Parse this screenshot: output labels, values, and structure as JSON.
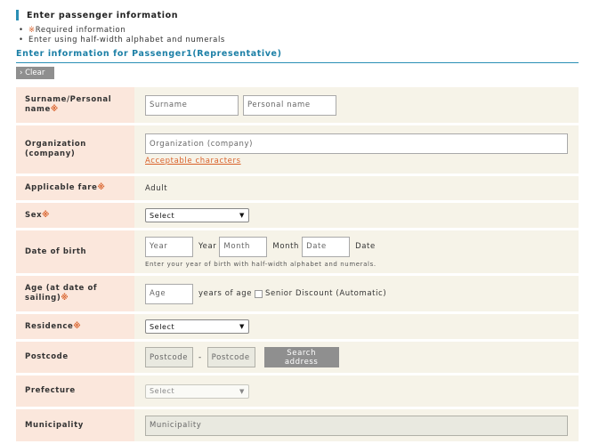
{
  "section": {
    "title": "Enter passenger information"
  },
  "notes": {
    "required_mark": "※",
    "required_text": "Required information",
    "alphanumeric": "Enter using half-width alphabet and numerals"
  },
  "passenger": {
    "title": "Enter information for Passenger1(Representative)"
  },
  "clear_button": "› Clear",
  "required_mark": "※",
  "rows": {
    "name": {
      "label": "Surname/Personal name",
      "surname_placeholder": "Surname",
      "personal_placeholder": "Personal name"
    },
    "organization": {
      "label": "Organization (company)",
      "placeholder": "Organization (company)",
      "link": "Acceptable characters"
    },
    "fare": {
      "label": "Applicable fare",
      "value": "Adult"
    },
    "sex": {
      "label": "Sex",
      "selected": "Select"
    },
    "dob": {
      "label": "Date of birth",
      "year_placeholder": "Year",
      "year_unit": "Year",
      "month_placeholder": "Month",
      "month_unit": "Month",
      "date_placeholder": "Date",
      "date_unit": "Date",
      "hint": "Enter your year of birth with half-width alphabet and numerals."
    },
    "age": {
      "label": "Age (at date of sailing)",
      "placeholder": "Age",
      "unit": "years of age",
      "discount": "Senior Discount (Automatic)"
    },
    "residence": {
      "label": "Residence",
      "selected": "Select"
    },
    "postcode": {
      "label": "Postcode",
      "placeholder1": "Postcode",
      "separator": "-",
      "placeholder2": "Postcode",
      "button": "Search address"
    },
    "prefecture": {
      "label": "Prefecture",
      "selected": "Select"
    },
    "municipality": {
      "label": "Municipality",
      "placeholder": "Municipality"
    }
  }
}
